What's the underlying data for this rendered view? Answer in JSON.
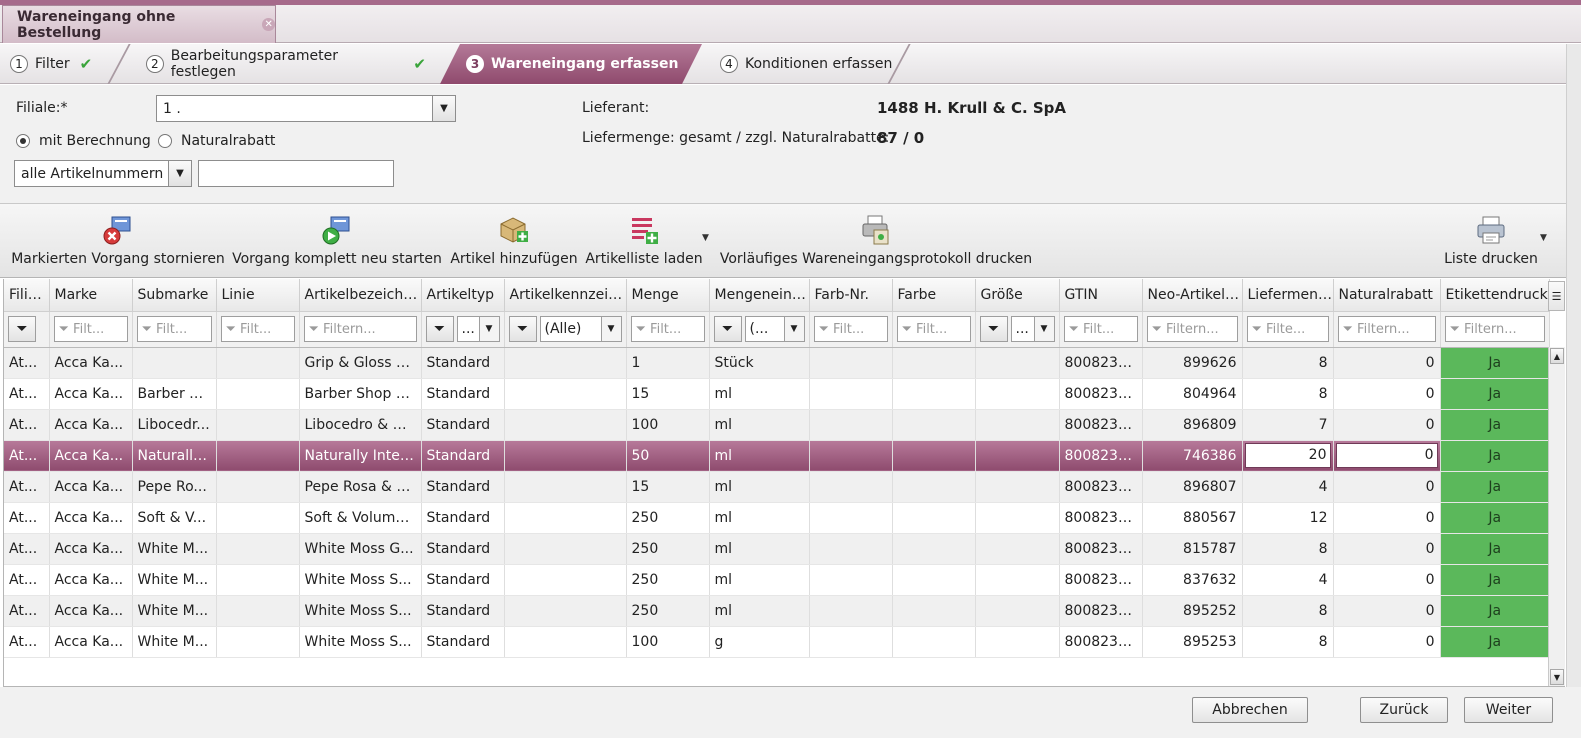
{
  "window": {
    "doc_tab": "Wareneingang ohne Bestellung"
  },
  "wizard": {
    "steps": [
      {
        "num": "1",
        "label": "Filter",
        "done": true
      },
      {
        "num": "2",
        "label": "Bearbeitungsparameter festlegen",
        "done": true
      },
      {
        "num": "3",
        "label": "Wareneingang erfassen",
        "active": true
      },
      {
        "num": "4",
        "label": "Konditionen erfassen"
      }
    ]
  },
  "form": {
    "filiale_label": "Filiale:*",
    "filiale_value": "1 .",
    "radio_mit": "mit Berechnung",
    "radio_natural": "Naturalrabatt",
    "artikel_select": "alle Artikelnummern",
    "lieferant_label": "Lieferant:",
    "lieferant_value": "1488 H. Krull & C. SpA",
    "liefermenge_label": "Liefermenge: gesamt / zzgl. Naturalrabatte:",
    "liefermenge_value": "87 / 0"
  },
  "toolbar": {
    "storno": "Markierten Vorgang stornieren",
    "neustart": "Vorgang komplett neu starten",
    "artikel_add": "Artikel hinzufügen",
    "artikelliste": "Artikelliste laden",
    "protokoll": "Vorläufiges Wareneingangsprotokoll drucken",
    "liste_drucken": "Liste drucken"
  },
  "grid": {
    "columns": [
      "Filiale",
      "Marke",
      "Submarke",
      "Linie",
      "Artikelbezeichn...",
      "Artikeltyp",
      "Artikelkennzeic...",
      "Menge",
      "Mengeneinh...",
      "Farb-Nr.",
      "Farbe",
      "Größe",
      "GTIN",
      "Neo-Artikel-...",
      "Liefermenge",
      "Naturalrabatt",
      "Etikettendruck"
    ],
    "filters": {
      "filt_short": "Filt...",
      "filtern": "Filtern...",
      "filte": "Filte...",
      "dots": "...",
      "alle": "(Alle)",
      "paren": "(..."
    },
    "rows": [
      [
        "At...",
        "Acca Ka...",
        "",
        "",
        "Grip & Gloss B...",
        "Standard",
        "",
        "1",
        "Stück",
        "",
        "",
        "",
        "8008230...",
        "899626",
        "8",
        "0",
        "Ja"
      ],
      [
        "At...",
        "Acca Ka...",
        "Barber S...",
        "",
        "Barber Shop M...",
        "Standard",
        "",
        "15",
        "ml",
        "",
        "",
        "",
        "8008230...",
        "804964",
        "8",
        "0",
        "Ja"
      ],
      [
        "At...",
        "Acca Ka...",
        "Libocedr...",
        "",
        "Libocedro & Sa...",
        "Standard",
        "",
        "100",
        "ml",
        "",
        "",
        "",
        "8008230...",
        "896809",
        "7",
        "0",
        "Ja"
      ],
      [
        "At...",
        "Acca Ka...",
        "Naturally...",
        "",
        "Naturally Inten...",
        "Standard",
        "",
        "50",
        "ml",
        "",
        "",
        "",
        "8008230...",
        "746386",
        "20",
        "0",
        "Ja"
      ],
      [
        "At...",
        "Acca Ka...",
        "Pepe Ro...",
        "",
        "Pepe Rosa & A...",
        "Standard",
        "",
        "15",
        "ml",
        "",
        "",
        "",
        "8008230...",
        "896807",
        "4",
        "0",
        "Ja"
      ],
      [
        "At...",
        "Acca Ka...",
        "Soft & V...",
        "",
        "Soft & Volume...",
        "Standard",
        "",
        "250",
        "ml",
        "",
        "",
        "",
        "8008230...",
        "880567",
        "12",
        "0",
        "Ja"
      ],
      [
        "At...",
        "Acca Ka...",
        "White M...",
        "",
        "White Moss G...",
        "Standard",
        "",
        "250",
        "ml",
        "",
        "",
        "",
        "8008230...",
        "815787",
        "8",
        "0",
        "Ja"
      ],
      [
        "At...",
        "Acca Ka...",
        "White M...",
        "",
        "White Moss S...",
        "Standard",
        "",
        "250",
        "ml",
        "",
        "",
        "",
        "8008230...",
        "837632",
        "4",
        "0",
        "Ja"
      ],
      [
        "At...",
        "Acca Ka...",
        "White M...",
        "",
        "White Moss S...",
        "Standard",
        "",
        "250",
        "ml",
        "",
        "",
        "",
        "8008230...",
        "895252",
        "8",
        "0",
        "Ja"
      ],
      [
        "At...",
        "Acca Ka...",
        "White M...",
        "",
        "White Moss S...",
        "Standard",
        "",
        "100",
        "g",
        "",
        "",
        "",
        "8008230...",
        "895253",
        "8",
        "0",
        "Ja"
      ]
    ],
    "selected_row": 3
  },
  "buttons": {
    "abbrechen": "Abbrechen",
    "zurueck": "Zurück",
    "weiter": "Weiter"
  },
  "colors": {
    "accent": "#8f4a6d",
    "etikett_green": "#5bb85b",
    "check_green": "#3aa43a"
  }
}
